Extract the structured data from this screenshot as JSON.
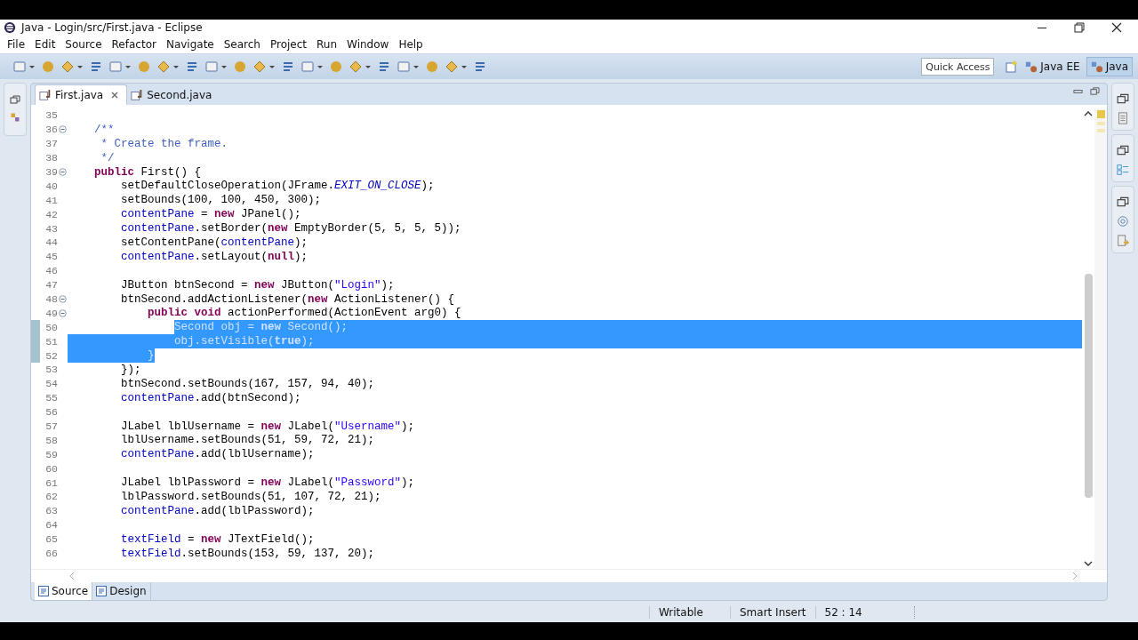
{
  "window": {
    "title": "Java - Login/src/First.java - Eclipse"
  },
  "menu": [
    "File",
    "Edit",
    "Source",
    "Refactor",
    "Navigate",
    "Search",
    "Project",
    "Run",
    "Window",
    "Help"
  ],
  "quick_access": {
    "placeholder": "Quick Access"
  },
  "perspectives": [
    {
      "label": "Java EE",
      "selected": false
    },
    {
      "label": "Java",
      "selected": true
    }
  ],
  "tabs": [
    {
      "label": "First.java",
      "selected": true
    },
    {
      "label": "Second.java",
      "selected": false
    }
  ],
  "lines": [
    {
      "number": "35",
      "fold": false,
      "selected": false
    },
    {
      "number": "36",
      "fold": true,
      "selected": false,
      "tokens": [
        {
          "kind": "comment",
          "text": "    /**"
        }
      ]
    },
    {
      "number": "37",
      "fold": false,
      "selected": false,
      "tokens": [
        {
          "kind": "comment",
          "text": "     * Create the frame."
        }
      ]
    },
    {
      "number": "38",
      "fold": false,
      "selected": false,
      "tokens": [
        {
          "kind": "comment",
          "text": "     */"
        }
      ]
    },
    {
      "number": "39",
      "fold": true,
      "selected": false,
      "tokens": [
        {
          "kind": "keyword",
          "text": "    public"
        },
        {
          "kind": "plain",
          "text": " First() {"
        }
      ]
    },
    {
      "number": "40",
      "fold": false,
      "selected": false,
      "tokens": [
        {
          "kind": "plain",
          "text": "        setDefaultCloseOperation(JFrame."
        },
        {
          "kind": "constant",
          "text": "EXIT_ON_CLOSE"
        },
        {
          "kind": "plain",
          "text": ");"
        }
      ]
    },
    {
      "number": "41",
      "fold": false,
      "selected": false,
      "tokens": [
        {
          "kind": "plain",
          "text": "        setBounds(100, 100, 450, 300);"
        }
      ]
    },
    {
      "number": "42",
      "fold": false,
      "selected": false,
      "tokens": [
        {
          "kind": "field",
          "text": "        contentPane"
        },
        {
          "kind": "plain",
          "text": " = "
        },
        {
          "kind": "keyword",
          "text": "new"
        },
        {
          "kind": "plain",
          "text": " JPanel();"
        }
      ]
    },
    {
      "number": "43",
      "fold": false,
      "selected": false,
      "tokens": [
        {
          "kind": "field",
          "text": "        contentPane"
        },
        {
          "kind": "plain",
          "text": ".setBorder("
        },
        {
          "kind": "keyword",
          "text": "new"
        },
        {
          "kind": "plain",
          "text": " EmptyBorder(5, 5, 5, 5));"
        }
      ]
    },
    {
      "number": "44",
      "fold": false,
      "selected": false,
      "tokens": [
        {
          "kind": "plain",
          "text": "        setContentPane("
        },
        {
          "kind": "field",
          "text": "contentPane"
        },
        {
          "kind": "plain",
          "text": ");"
        }
      ]
    },
    {
      "number": "45",
      "fold": false,
      "selected": false,
      "tokens": [
        {
          "kind": "field",
          "text": "        contentPane"
        },
        {
          "kind": "plain",
          "text": ".setLayout("
        },
        {
          "kind": "keyword",
          "text": "null"
        },
        {
          "kind": "plain",
          "text": ");"
        }
      ]
    },
    {
      "number": "46",
      "fold": false,
      "selected": false
    },
    {
      "number": "47",
      "fold": false,
      "selected": false,
      "tokens": [
        {
          "kind": "plain",
          "text": "        JButton btnSecond = "
        },
        {
          "kind": "keyword",
          "text": "new"
        },
        {
          "kind": "plain",
          "text": " JButton("
        },
        {
          "kind": "string",
          "text": "\"Login\""
        },
        {
          "kind": "plain",
          "text": ");"
        }
      ]
    },
    {
      "number": "48",
      "fold": true,
      "selected": false,
      "tokens": [
        {
          "kind": "plain",
          "text": "        btnSecond.addActionListener("
        },
        {
          "kind": "keyword",
          "text": "new"
        },
        {
          "kind": "plain",
          "text": " ActionListener() {"
        }
      ]
    },
    {
      "number": "49",
      "fold": true,
      "selected": false,
      "tokens": [
        {
          "kind": "keyword",
          "text": "            public void"
        },
        {
          "kind": "plain",
          "text": " actionPerformed(ActionEvent arg0) {"
        }
      ]
    },
    {
      "number": "50",
      "fold": false,
      "selected": true,
      "tokens": [
        {
          "kind": "plain",
          "text": "                Second obj = "
        },
        {
          "kind": "keyword",
          "text": "new"
        },
        {
          "kind": "plain",
          "text": " Second();"
        }
      ]
    },
    {
      "number": "51",
      "fold": false,
      "selected": true,
      "tokens": [
        {
          "kind": "plain",
          "text": "                obj.setVisible("
        },
        {
          "kind": "keyword",
          "text": "true"
        },
        {
          "kind": "plain",
          "text": ");"
        }
      ]
    },
    {
      "number": "52",
      "fold": false,
      "selected": true,
      "tokens": [
        {
          "kind": "plain",
          "text": "            }"
        }
      ]
    },
    {
      "number": "53",
      "fold": false,
      "selected": false,
      "tokens": [
        {
          "kind": "plain",
          "text": "        });"
        }
      ]
    },
    {
      "number": "54",
      "fold": false,
      "selected": false,
      "tokens": [
        {
          "kind": "plain",
          "text": "        btnSecond.setBounds(167, 157, 94, 40);"
        }
      ]
    },
    {
      "number": "55",
      "fold": false,
      "selected": false,
      "tokens": [
        {
          "kind": "field",
          "text": "        contentPane"
        },
        {
          "kind": "plain",
          "text": ".add(btnSecond);"
        }
      ]
    },
    {
      "number": "56",
      "fold": false,
      "selected": false
    },
    {
      "number": "57",
      "fold": false,
      "selected": false,
      "tokens": [
        {
          "kind": "plain",
          "text": "        JLabel lblUsername = "
        },
        {
          "kind": "keyword",
          "text": "new"
        },
        {
          "kind": "plain",
          "text": " JLabel("
        },
        {
          "kind": "string",
          "text": "\"Username\""
        },
        {
          "kind": "plain",
          "text": ");"
        }
      ]
    },
    {
      "number": "58",
      "fold": false,
      "selected": false,
      "tokens": [
        {
          "kind": "plain",
          "text": "        lblUsername.setBounds(51, 59, 72, 21);"
        }
      ]
    },
    {
      "number": "59",
      "fold": false,
      "selected": false,
      "tokens": [
        {
          "kind": "field",
          "text": "        contentPane"
        },
        {
          "kind": "plain",
          "text": ".add(lblUsername);"
        }
      ]
    },
    {
      "number": "60",
      "fold": false,
      "selected": false
    },
    {
      "number": "61",
      "fold": false,
      "selected": false,
      "tokens": [
        {
          "kind": "plain",
          "text": "        JLabel lblPassword = "
        },
        {
          "kind": "keyword",
          "text": "new"
        },
        {
          "kind": "plain",
          "text": " JLabel("
        },
        {
          "kind": "string",
          "text": "\"Password\""
        },
        {
          "kind": "plain",
          "text": ");"
        }
      ]
    },
    {
      "number": "62",
      "fold": false,
      "selected": false,
      "tokens": [
        {
          "kind": "plain",
          "text": "        lblPassword.setBounds(51, 107, 72, 21);"
        }
      ]
    },
    {
      "number": "63",
      "fold": false,
      "selected": false,
      "tokens": [
        {
          "kind": "field",
          "text": "        contentPane"
        },
        {
          "kind": "plain",
          "text": ".add(lblPassword);"
        }
      ]
    },
    {
      "number": "64",
      "fold": false,
      "selected": false
    },
    {
      "number": "65",
      "fold": false,
      "selected": false,
      "tokens": [
        {
          "kind": "field",
          "text": "        textField"
        },
        {
          "kind": "plain",
          "text": " = "
        },
        {
          "kind": "keyword",
          "text": "new"
        },
        {
          "kind": "plain",
          "text": " JTextField();"
        }
      ]
    },
    {
      "number": "66",
      "fold": false,
      "selected": false,
      "tokens": [
        {
          "kind": "field",
          "text": "        textField"
        },
        {
          "kind": "plain",
          "text": ".setBounds(153, 59, 137, 20);"
        }
      ]
    }
  ],
  "bottom_tabs": [
    {
      "label": "Source",
      "selected": true
    },
    {
      "label": "Design",
      "selected": false
    }
  ],
  "status_bar": [
    "Writable",
    "Smart Insert",
    "52 : 14"
  ]
}
